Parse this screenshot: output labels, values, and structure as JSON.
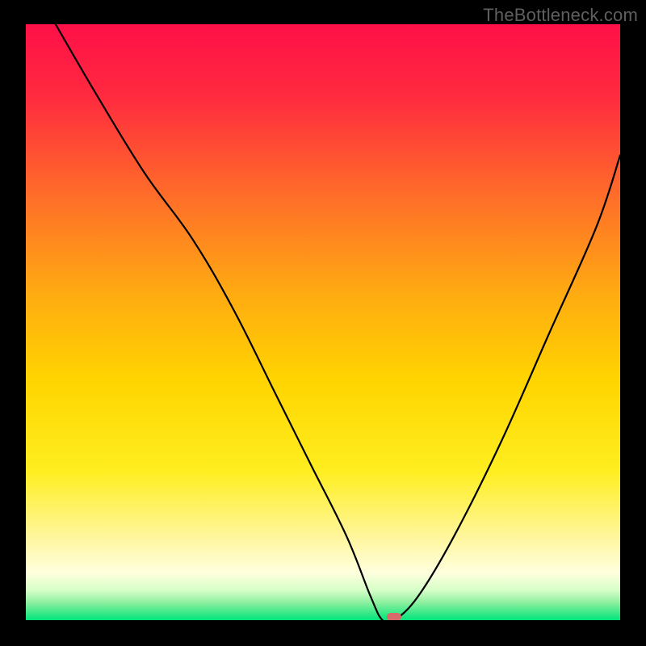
{
  "watermark": "TheBottleneck.com",
  "colors": {
    "background": "#000000",
    "curve": "#000000",
    "marker": "#d76a6a"
  },
  "chart_data": {
    "type": "line",
    "title": "",
    "xlabel": "",
    "ylabel": "",
    "xlim": [
      0,
      100
    ],
    "ylim": [
      0,
      100
    ],
    "series": [
      {
        "name": "bottleneck-curve",
        "x": [
          5,
          12,
          20,
          28,
          35,
          42,
          48,
          54,
          58,
          60,
          62,
          66,
          72,
          80,
          88,
          96,
          100
        ],
        "y": [
          100,
          88,
          75,
          64,
          52,
          38,
          26,
          14,
          4,
          0,
          0,
          4,
          14,
          30,
          48,
          66,
          78
        ]
      }
    ],
    "optimal_point": {
      "x": 62,
      "y": 0
    },
    "description": "V-shaped mismatch curve over a vertical green-to-red gradient; minimum (optimal match) marked by the pill near x≈62."
  }
}
